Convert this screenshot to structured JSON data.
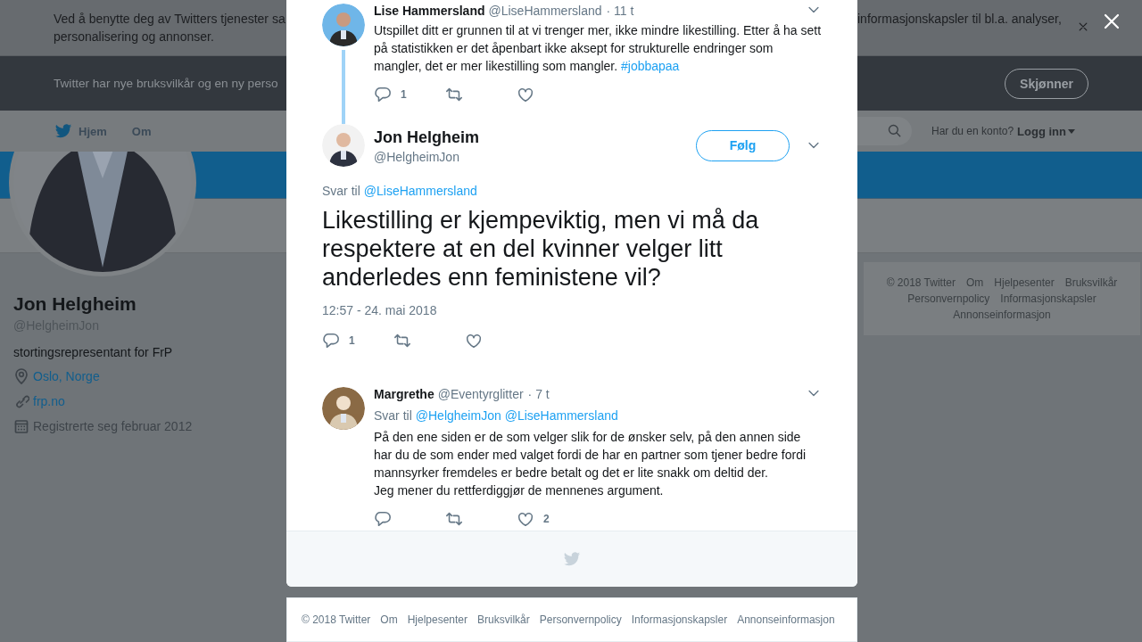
{
  "cookie_banner": {
    "line1_start": "Ved å benytte deg av Twitters tjenester sa",
    "line1_end": "informasjonskapsler til bl.a. analyser,",
    "line2": "personalisering og annonser."
  },
  "terms_banner": {
    "text": "Twitter har nye bruksvilkår og en ny perso",
    "button": "Skjønner"
  },
  "nav": {
    "items": [
      "Hjem",
      "Om"
    ],
    "account_prompt": "Har du en konto?",
    "login": "Logg inn"
  },
  "profile": {
    "name": "Jon Helgheim",
    "handle": "@HelgheimJon",
    "bio": "stortingsrepresentant for FrP",
    "location": "Oslo, Norge",
    "url": "frp.no",
    "joined": "Registrerte seg februar 2012"
  },
  "side_footer": {
    "links": [
      "© 2018 Twitter",
      "Om",
      "Hjelpesenter",
      "Bruksvilkår",
      "Personvernpolicy",
      "Informasjonskapsler",
      "Annonseinformasjon"
    ]
  },
  "modal": {
    "tweets": [
      {
        "kind": "thread",
        "name": "Lise Hammersland",
        "handle": "@LiseHammersland",
        "time": "· 11 t",
        "text": "Utspillet ditt er grunnen til at vi trenger mer, ikke mindre likestilling. Etter å ha sett på statistikken er det åpenbart ikke aksept for strukturelle endringer som mangler, det er mer likestilling som mangler.",
        "hashtag": "#jobbapaa",
        "replies": "1"
      },
      {
        "kind": "main",
        "name": "Jon Helgheim",
        "handle": "@HelgheimJon",
        "follow": "Følg",
        "reply_label": "Svar til",
        "reply_to": [
          "@LiseHammersland"
        ],
        "text": "Likestilling er kjempeviktig, men vi må da respektere at en del kvinner velger litt anderledes enn feministene vil?",
        "timestamp": "12:57 - 24. mai 2018",
        "replies": "1"
      },
      {
        "kind": "reply",
        "name": "Margrethe",
        "handle": "@Eventyrglitter",
        "time": "· 7 t",
        "reply_label": "Svar til",
        "reply_to": [
          "@HelgheimJon",
          "@LiseHammersland"
        ],
        "text": "På den ene siden er de som velger slik for de ønsker selv, på den annen side har du de som ender med valget fordi de har en partner som tjener bedre fordi mannsyrker fremdeles er bedre betalt og det er lite snakk om deltid der.\nJeg mener du rettferdiggjør de mennenes argument.",
        "likes": "2"
      }
    ]
  },
  "page_footer": {
    "links": [
      "© 2018 Twitter",
      "Om",
      "Hjelpesenter",
      "Bruksvilkår",
      "Personvernpolicy",
      "Informasjonskapsler",
      "Annonseinformasjon"
    ]
  }
}
